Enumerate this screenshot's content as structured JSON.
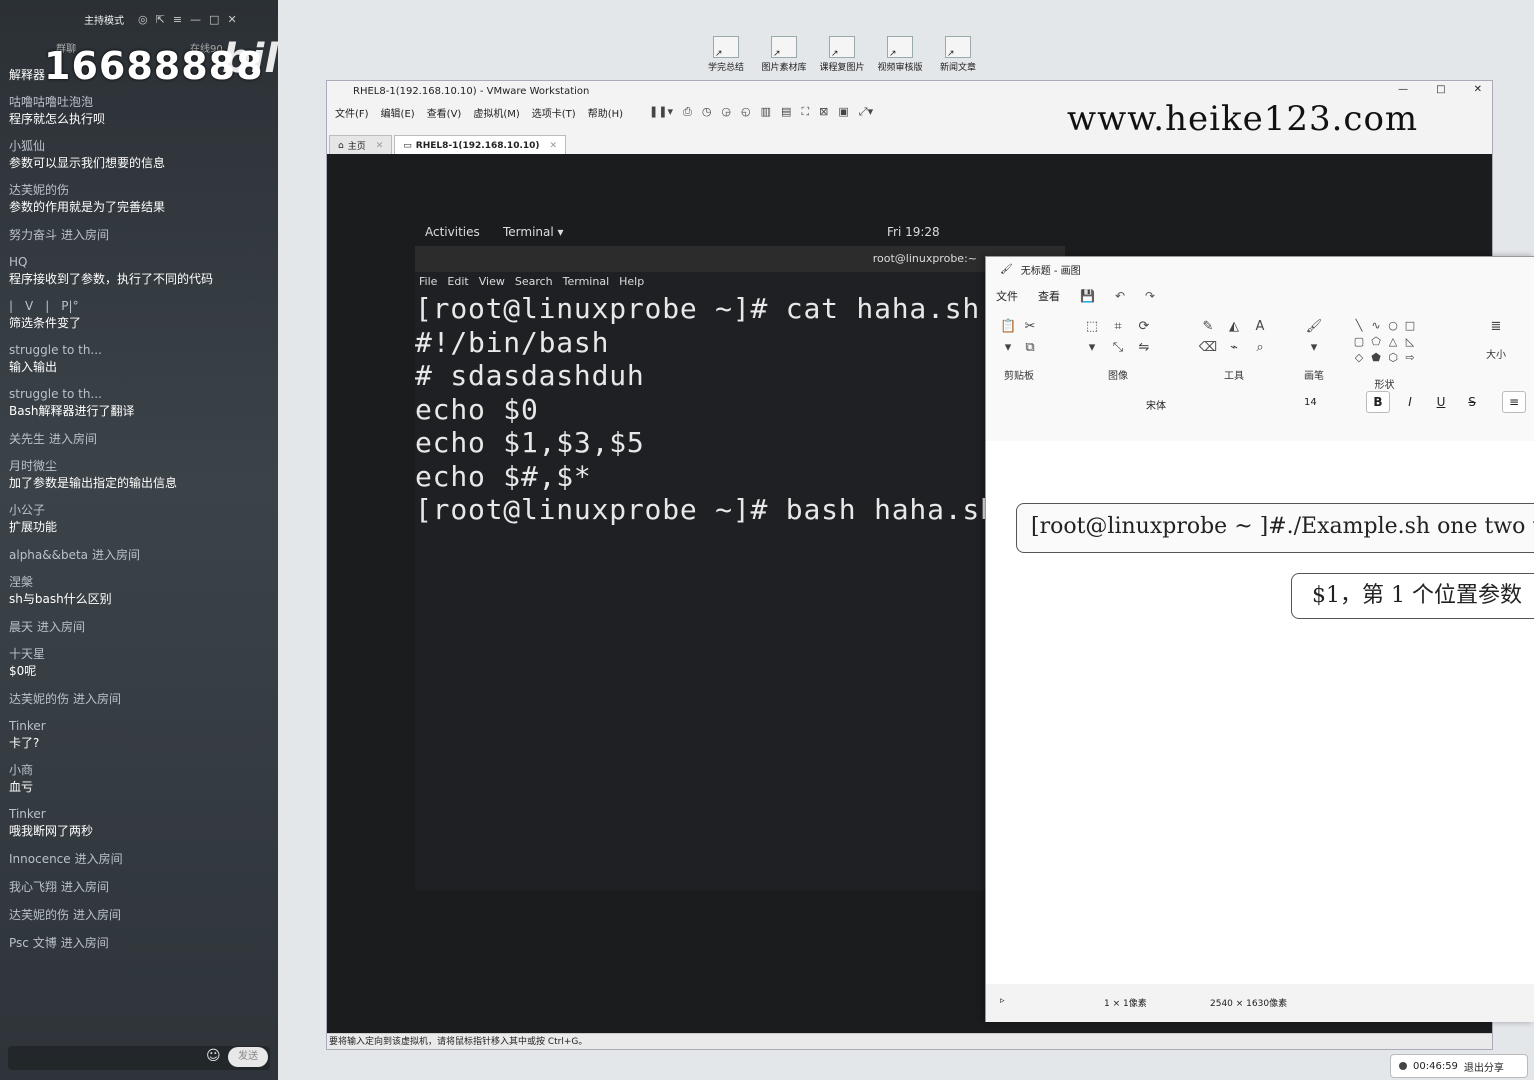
{
  "chat": {
    "mode_label": "主持模式",
    "tab_label": "群聊",
    "online_label": "在线90",
    "room_number": "16688888",
    "logo_text": "bilibili",
    "header_partial": "解释器",
    "messages": [
      {
        "name": "咕噜咕噜吐泡泡",
        "text": "程序就怎么执行呗"
      },
      {
        "name": "小狐仙",
        "text": "参数可以显示我们想要的信息"
      },
      {
        "name": "达芙妮的伤",
        "text": "参数的作用就是为了完善结果"
      },
      {
        "name": "努力奋斗",
        "text": "进入房间",
        "join": true
      },
      {
        "name": "HQ",
        "text": "程序接收到了参数，执行了不同的代码"
      },
      {
        "name": "|　V　|　P|°",
        "text": "筛选条件变了"
      },
      {
        "name": "struggle to th...",
        "text": "输入输出"
      },
      {
        "name": "struggle to th...",
        "text": "Bash解释器进行了翻译"
      },
      {
        "name": "关先生",
        "text": "进入房间",
        "join": true
      },
      {
        "name": "月时微尘",
        "text": "加了参数是输出指定的输出信息"
      },
      {
        "name": "小公子",
        "text": "扩展功能"
      },
      {
        "name": "alpha&&beta",
        "text": "进入房间",
        "join": true
      },
      {
        "name": "涅槃",
        "text": "sh与bash什么区别"
      },
      {
        "name": "晨天",
        "text": "进入房间",
        "join": true
      },
      {
        "name": "十天星",
        "text": "$0呢"
      },
      {
        "name": "达芙妮的伤",
        "text": "进入房间",
        "join": true
      },
      {
        "name": "Tinker",
        "text": "卡了?"
      },
      {
        "name": "小商",
        "text": "血亏"
      },
      {
        "name": "Tinker",
        "text": "哦我断网了两秒"
      },
      {
        "name": "Innocence",
        "text": "进入房间",
        "join": true
      },
      {
        "name": "我心飞翔",
        "text": "进入房间",
        "join": true
      },
      {
        "name": "达芙妮的伤",
        "text": "进入房间",
        "join": true
      },
      {
        "name": "Psc 文博",
        "text": "进入房间",
        "join": true
      }
    ],
    "send_label": "发送"
  },
  "desktop_icons": [
    {
      "label": "学完总结",
      "icon": "shortcut-icon"
    },
    {
      "label": "图片素材库",
      "icon": "shortcut-icon"
    },
    {
      "label": "课程复图片",
      "icon": "shortcut-icon"
    },
    {
      "label": "视频审核版",
      "icon": "shortcut-icon"
    },
    {
      "label": "新闻文章",
      "icon": "shortcut-icon"
    }
  ],
  "vmware": {
    "title": "RHEL8-1(192.168.10.10) - VMware Workstation",
    "menu": [
      "文件(F)",
      "编辑(E)",
      "查看(V)",
      "虚拟机(M)",
      "选项卡(T)",
      "帮助(H)"
    ],
    "watermark": "www.heike123.com",
    "tabs": [
      {
        "label": "主页",
        "active": false
      },
      {
        "label": "RHEL8-1(192.168.10.10)",
        "active": true
      }
    ],
    "status": "要将输入定向到该虚拟机，请将鼠标指针移入其中或按 Ctrl+G。"
  },
  "gnome": {
    "activities": "Activities",
    "app": "Terminal ▾",
    "clock": "Fri 19:28"
  },
  "terminal": {
    "header": "root@linuxprobe:~",
    "menu": [
      "File",
      "Edit",
      "View",
      "Search",
      "Terminal",
      "Help"
    ],
    "lines": [
      "[root@linuxprobe ~]# cat haha.sh",
      "#!/bin/bash",
      "# sdasdashduh",
      "echo $0",
      "echo $1,$3,$5",
      "echo $#,$*",
      "[root@linuxprobe ~]# bash haha.sh"
    ]
  },
  "paint": {
    "title": "无标题 - 画图",
    "menu": [
      "文件",
      "查看"
    ],
    "groups": [
      "剪贴板",
      "图像",
      "工具",
      "画笔",
      "形状",
      "大小"
    ],
    "font": "宋体",
    "size": "14",
    "format_buttons": [
      "B",
      "I",
      "U",
      "S"
    ],
    "command_text": "[root@linuxprobe ~ ]#./Example.sh one two three four five six",
    "callout_text": "$1，第 1 个位置参数",
    "status_selection": "1 × 1像素",
    "status_canvas": "2540 × 1630像素"
  },
  "share": {
    "timer": "00:46:59",
    "exit_label": "退出分享"
  }
}
